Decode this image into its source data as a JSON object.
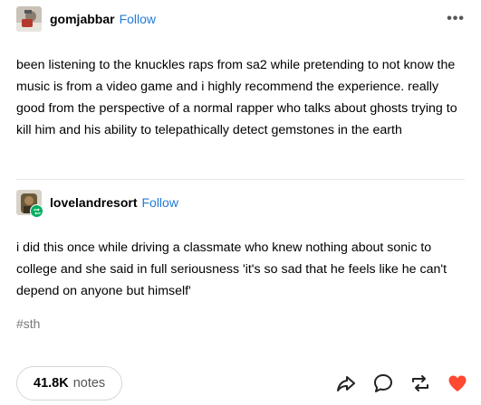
{
  "post": {
    "author": "gomjabbar",
    "follow_label": "Follow",
    "more_label": "•••",
    "text": "been listening to the knuckles raps from sa2 while pretending to not know the music is from a video game and i highly recommend the experience. really good from the perspective of a normal rapper who talks about ghosts trying to kill him and his ability to telepathically detect gemstones in the earth"
  },
  "reblog": {
    "author": "lovelandresort",
    "follow_label": "Follow",
    "text": "i did this once while driving a classmate who knew nothing about sonic to college and she said in full seriousness 'it's so sad that he feels like he can't depend on anyone but himself'"
  },
  "tags": [
    "#sth"
  ],
  "footer": {
    "notes_count": "41.8K",
    "notes_label": "notes"
  },
  "icons": {
    "share": "share-icon",
    "reply": "reply-icon",
    "reblog": "reblog-icon",
    "like": "heart-icon"
  },
  "colors": {
    "follow": "#1f7bd8",
    "like": "#ff4930",
    "reblog_badge": "#00b060",
    "tag": "#777777"
  }
}
